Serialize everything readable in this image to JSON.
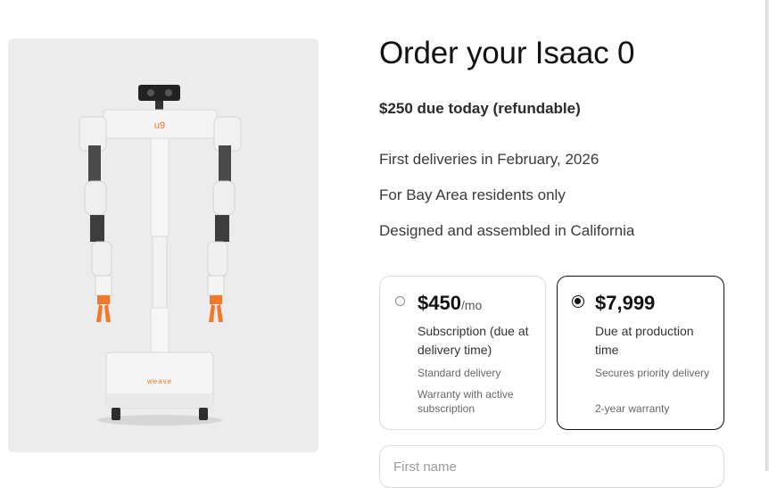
{
  "order": {
    "title": "Order your Isaac 0",
    "due_today": "$250 due today (refundable)",
    "features": [
      "First deliveries in February, 2026",
      "For Bay Area residents only",
      "Designed and assembled in California"
    ]
  },
  "plans": [
    {
      "price": "$450",
      "price_unit": "/mo",
      "description": "Subscription (due at delivery time)",
      "details": [
        "Standard delivery",
        "Warranty with active subscription"
      ],
      "selected": false
    },
    {
      "price": "$7,999",
      "price_unit": "",
      "description": "Due at production time",
      "details": [
        "Secures priority delivery",
        "2-year warranty"
      ],
      "selected": true
    }
  ],
  "form": {
    "first_name_placeholder": "First name"
  },
  "image": {
    "head_logo": "u9",
    "base_logo": "weave"
  },
  "colors": {
    "accent": "#f07a2a",
    "photo_background": "#ececec"
  }
}
